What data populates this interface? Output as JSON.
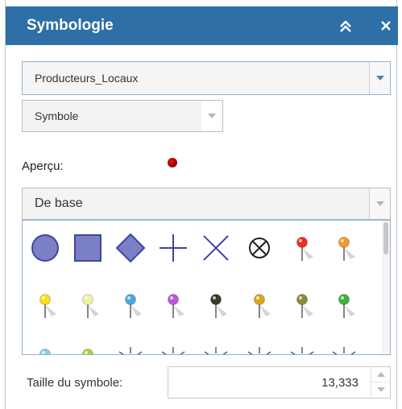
{
  "panel": {
    "title": "Symbologie",
    "header_color": "#2d6fa6",
    "collapse_icon": "double-chevron-up-icon",
    "close_icon": "close-icon"
  },
  "layer_select": {
    "value": "Producteurs_Locaux"
  },
  "type_select": {
    "value": "Symbole"
  },
  "preview": {
    "label": "Aperçu:",
    "symbol_color": "#a00000"
  },
  "category_select": {
    "value": "De base"
  },
  "symbols": {
    "row1": [
      "circle",
      "square",
      "diamond",
      "cross",
      "x",
      "circle-x",
      "pin-red",
      "pin-orange"
    ],
    "row2": [
      "pin-yellow",
      "pin-pale-yellow",
      "pin-blue",
      "pin-purple",
      "pin-black",
      "pin-gold",
      "pin-olive",
      "pin-green"
    ],
    "row3_partial": [
      "pin-teal",
      "pin-lime",
      "sun",
      "sun",
      "sun",
      "sun",
      "sun",
      "sun"
    ]
  },
  "symbol_fill": "#7b7fc4",
  "symbol_stroke": "#3f45a0",
  "size": {
    "label": "Taille du symbole:",
    "value": "13,333"
  }
}
